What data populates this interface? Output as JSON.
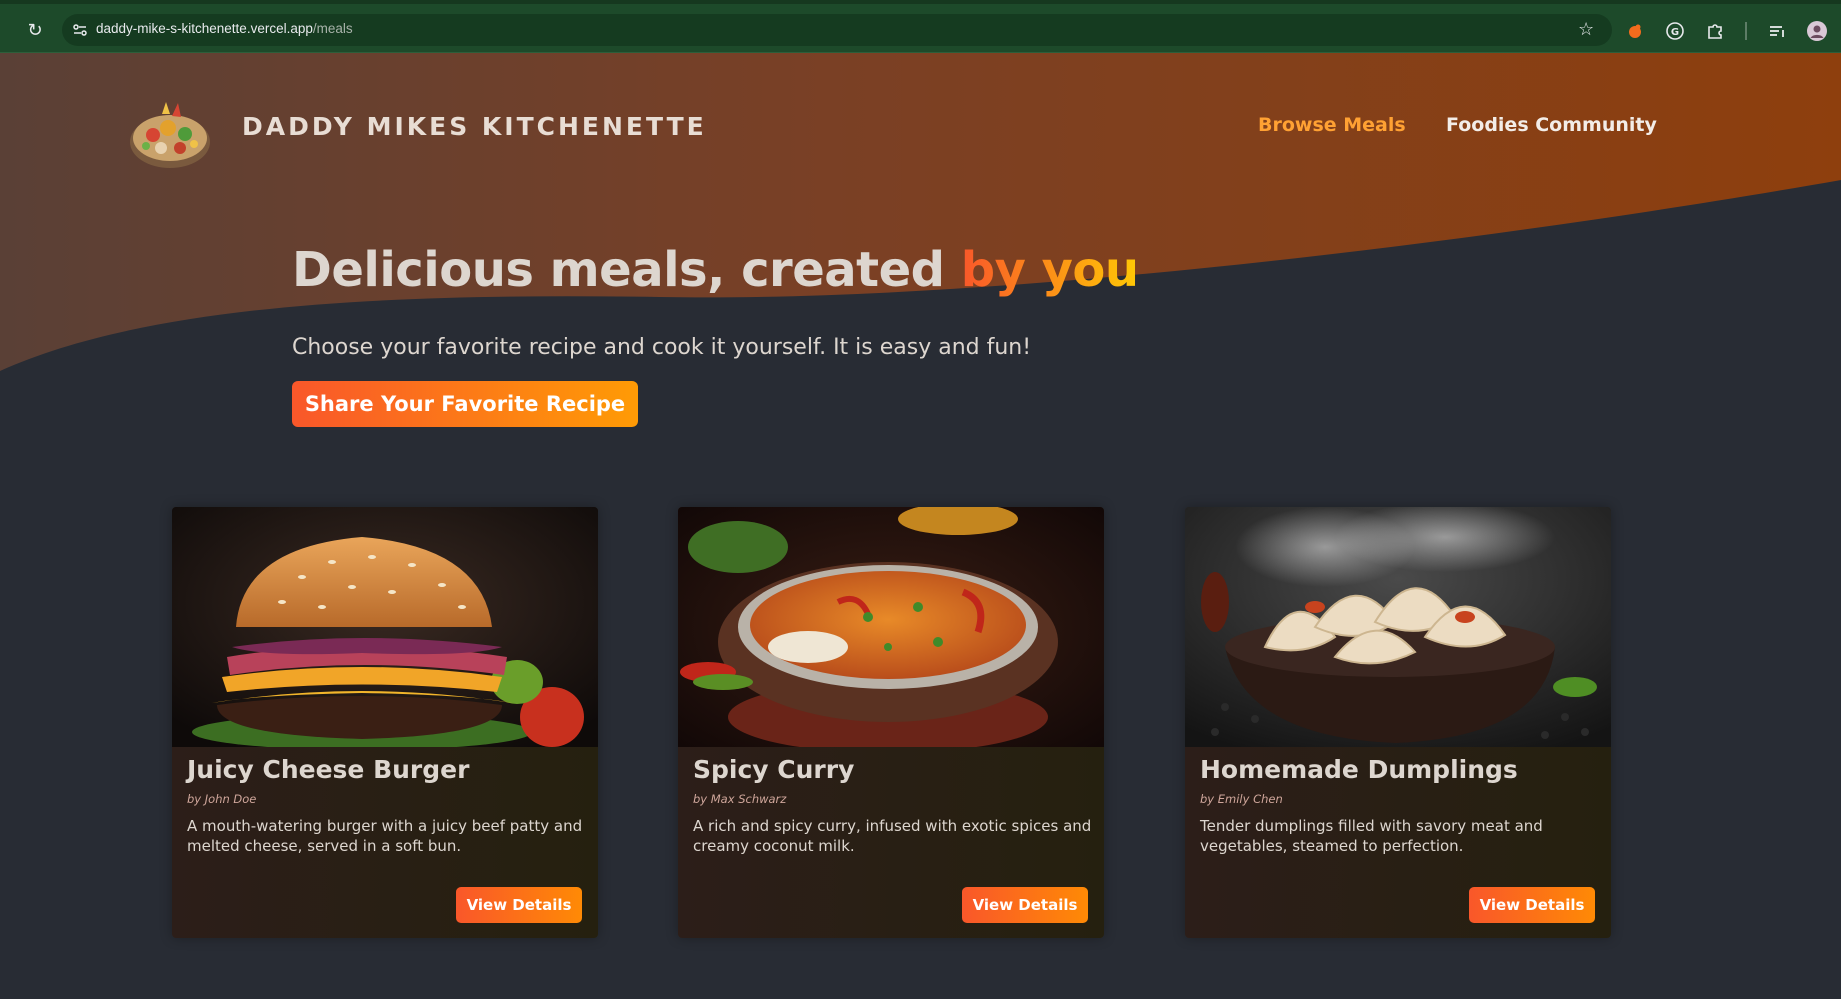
{
  "browser": {
    "url_host": "daddy-mike-s-kitchenette.vercel.app",
    "url_path": "/meals",
    "icons": [
      "reload-icon",
      "site-info-icon",
      "star-icon",
      "extension-fire-icon",
      "grammarly-icon",
      "extensions-puzzle-icon",
      "reading-list-icon",
      "profile-avatar"
    ]
  },
  "header": {
    "brand": "DADDY MIKES KITCHENETTE",
    "nav": {
      "browse": "Browse Meals",
      "community": "Foodies Community"
    }
  },
  "hero": {
    "title_main": "Delicious meals, created ",
    "title_accent": "by you",
    "subtitle": "Choose your favorite recipe and cook it yourself. It is easy and fun!",
    "share_button": "Share Your Favorite Recipe"
  },
  "meals": [
    {
      "title": "Juicy Cheese Burger",
      "author": "by John Doe",
      "description": "A mouth-watering burger with a juicy beef patty and melted cheese, served in a soft bun.",
      "button": "View Details",
      "image": "burger-image"
    },
    {
      "title": "Spicy Curry",
      "author": "by Max Schwarz",
      "description": "A rich and spicy curry, infused with exotic spices and creamy coconut milk.",
      "button": "View Details",
      "image": "curry-image"
    },
    {
      "title": "Homemade Dumplings",
      "author": "by Emily Chen",
      "description": "Tender dumplings filled with savory meat and vegetables, steamed to perfection.",
      "button": "View Details",
      "image": "dumplings-image"
    }
  ],
  "colors": {
    "page_background": "#282c34",
    "header_gradient_start": "#5a3f36",
    "header_gradient_end": "#8b3f0f",
    "accent_orange": "#f9572a",
    "accent_yellow": "#ffc905",
    "nav_active": "#ffa133",
    "browser_bar": "#1d4a2a"
  }
}
